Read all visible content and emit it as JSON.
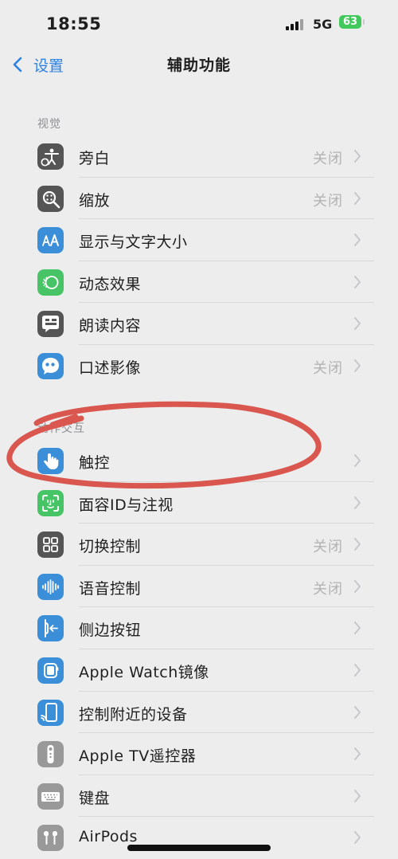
{
  "status_bar": {
    "time": "18:55",
    "network": "5G",
    "battery": "63"
  },
  "nav": {
    "back_label": "设置",
    "title": "辅助功能"
  },
  "sections": [
    {
      "header": "视觉",
      "items": [
        {
          "label": "旁白",
          "value": "关闭",
          "icon": "voiceover-icon",
          "color": "#555555"
        },
        {
          "label": "缩放",
          "value": "关闭",
          "icon": "zoom-icon",
          "color": "#555555"
        },
        {
          "label": "显示与文字大小",
          "value": "",
          "icon": "text-size-icon",
          "color": "#3b8ed8"
        },
        {
          "label": "动态效果",
          "value": "",
          "icon": "motion-icon",
          "color": "#47c465"
        },
        {
          "label": "朗读内容",
          "value": "",
          "icon": "spoken-content-icon",
          "color": "#555555"
        },
        {
          "label": "口述影像",
          "value": "关闭",
          "icon": "audio-description-icon",
          "color": "#3b8ed8"
        }
      ]
    },
    {
      "header": "动作交互",
      "items": [
        {
          "label": "触控",
          "value": "",
          "icon": "touch-icon",
          "color": "#3b8ed8"
        },
        {
          "label": "面容ID与注视",
          "value": "",
          "icon": "face-id-icon",
          "color": "#47c465"
        },
        {
          "label": "切换控制",
          "value": "关闭",
          "icon": "switch-control-icon",
          "color": "#555555"
        },
        {
          "label": "语音控制",
          "value": "关闭",
          "icon": "voice-control-icon",
          "color": "#3b8ed8"
        },
        {
          "label": "侧边按钮",
          "value": "",
          "icon": "side-button-icon",
          "color": "#3b8ed8"
        },
        {
          "label": "Apple Watch镜像",
          "value": "",
          "icon": "apple-watch-mirroring-icon",
          "color": "#3b8ed8"
        },
        {
          "label": "控制附近的设备",
          "value": "",
          "icon": "control-nearby-devices-icon",
          "color": "#3b8ed8"
        },
        {
          "label": "Apple TV遥控器",
          "value": "",
          "icon": "apple-tv-remote-icon",
          "color": "#999999"
        },
        {
          "label": "键盘",
          "value": "",
          "icon": "keyboard-icon",
          "color": "#999999"
        },
        {
          "label": "AirPods",
          "value": "",
          "icon": "airpods-icon",
          "color": "#999999"
        }
      ]
    }
  ]
}
